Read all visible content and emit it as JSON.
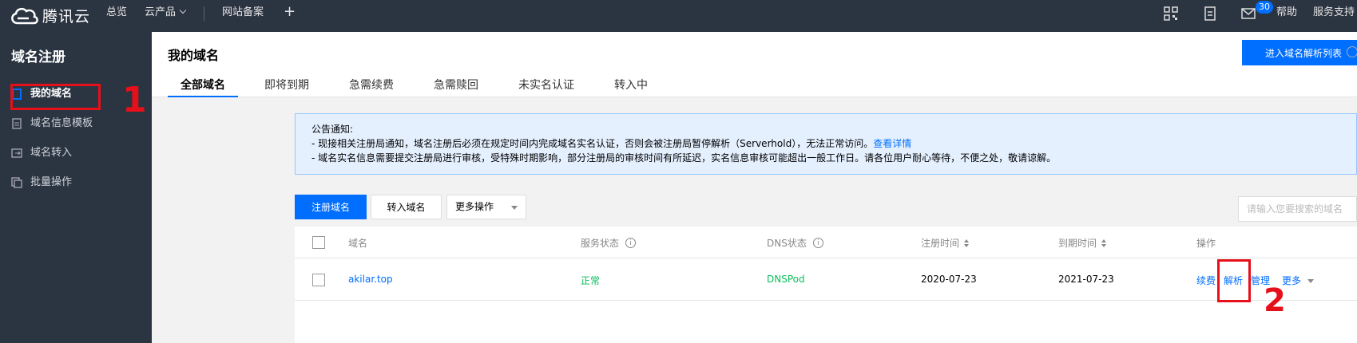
{
  "brand": {
    "name": "腾讯云"
  },
  "topnav": {
    "overview": "总览",
    "products": "云产品",
    "icp": "网站备案",
    "add": "+",
    "badge_count": "30",
    "help": "帮助",
    "support": "服务支持"
  },
  "sidebar": {
    "title": "域名注册",
    "items": [
      {
        "label": "我的域名",
        "icon": "monitor-icon"
      },
      {
        "label": "域名信息模板",
        "icon": "document-icon"
      },
      {
        "label": "域名转入",
        "icon": "transfer-icon"
      },
      {
        "label": "批量操作",
        "icon": "copy-icon"
      }
    ]
  },
  "header": {
    "title": "我的域名",
    "dns_list_button": "进入域名解析列表",
    "tabs": [
      "全部域名",
      "即将到期",
      "急需续费",
      "急需赎回",
      "未实名认证",
      "转入中"
    ]
  },
  "notice": {
    "title": "公告通知:",
    "line1": "- 现接相关注册局通知，域名注册后必须在规定时间内完成域名实名认证，否则会被注册局暂停解析（Serverhold），无法正常访问。",
    "line1_link": "查看详情",
    "line2": "- 域名实名信息需要提交注册局进行审核，受特殊时期影响，部分注册局的审核时间有所延迟，实名信息审核可能超出一般工作日。请各位用户耐心等待，不便之处，敬请谅解。"
  },
  "toolbar": {
    "register": "注册域名",
    "transfer": "转入域名",
    "more_ops": "更多操作",
    "search_placeholder": "请输入您要搜索的域名"
  },
  "table": {
    "columns": [
      "域名",
      "服务状态",
      "DNS状态",
      "注册时间",
      "到期时间",
      "操作"
    ],
    "rows": [
      {
        "domain": "akilar.top",
        "status": "正常",
        "dns": "DNSPod",
        "registered": "2020-07-23",
        "expires": "2021-07-23",
        "actions": [
          "续费",
          "解析",
          "管理",
          "更多"
        ]
      }
    ]
  },
  "annotations": {
    "one": "1",
    "two": "2"
  },
  "colors": {
    "accent": "#006eff",
    "highlight": "#e6101a",
    "ok": "#0abf5b",
    "nav_bg": "#2b3441"
  }
}
